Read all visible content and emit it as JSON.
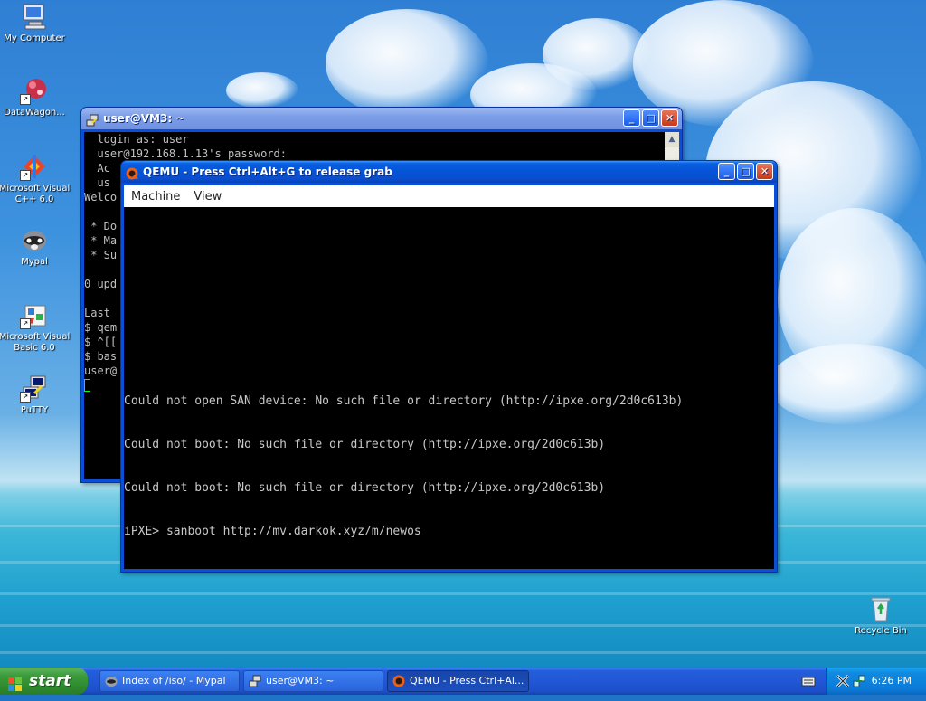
{
  "desktop": {
    "icons": [
      {
        "label": "My Computer",
        "icon": "my-computer-icon"
      },
      {
        "label": "DataWagon...",
        "icon": "datawagon-icon"
      },
      {
        "label": "Microsoft Visual C++ 6.0",
        "icon": "visual-cpp-icon"
      },
      {
        "label": "Mypal",
        "icon": "mypal-icon"
      },
      {
        "label": "Microsoft Visual Basic 6.0",
        "icon": "visual-basic-icon"
      },
      {
        "label": "PuTTY",
        "icon": "putty-icon"
      },
      {
        "label": "Recycle Bin",
        "icon": "recycle-bin-icon"
      }
    ]
  },
  "putty_window": {
    "title": "user@VM3: ~",
    "lines": [
      "  login as: user",
      "  user@192.168.1.13's password:",
      "  Ac",
      "  us",
      "Welco",
      "",
      " * Do",
      " * Ma",
      " * Su",
      "",
      "0 upd",
      "",
      "Last",
      "$ qem",
      "$ ^[[",
      "$ bas",
      "user@"
    ]
  },
  "qemu_window": {
    "title": "QEMU - Press Ctrl+Alt+G to release grab",
    "menu": [
      "Machine",
      "View"
    ],
    "screen_lines": [
      "Could not open SAN device: No such file or directory (http://ipxe.org/2d0c613b)",
      "Could not boot: No such file or directory (http://ipxe.org/2d0c613b)",
      "Could not boot: No such file or directory (http://ipxe.org/2d0c613b)",
      "iPXE> sanboot http://mv.darkok.xyz/m/newos"
    ]
  },
  "taskbar": {
    "start_label": "start",
    "tasks": [
      {
        "label": "Index of /iso/ - Mypal",
        "icon": "mypal-icon",
        "active": false
      },
      {
        "label": "user@VM3: ~",
        "icon": "putty-icon",
        "active": false
      },
      {
        "label": "QEMU - Press Ctrl+Al...",
        "icon": "qemu-icon",
        "active": true
      }
    ],
    "clock": "6:26 PM"
  }
}
